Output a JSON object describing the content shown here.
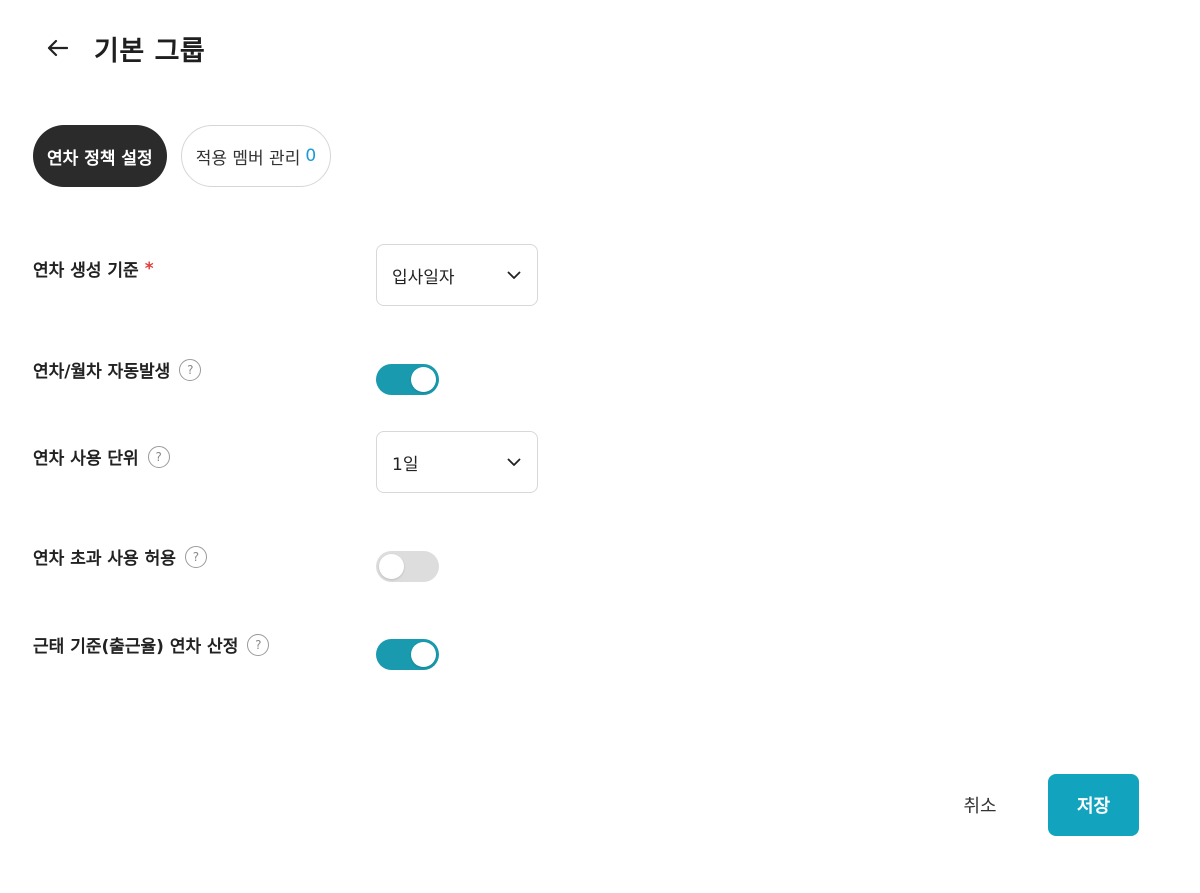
{
  "header": {
    "title": "기본 그룹",
    "back_icon": "arrow-left-icon"
  },
  "tabs": [
    {
      "label": "연차 정책 설정",
      "active": true
    },
    {
      "label": "적용 멤버 관리",
      "count": "0",
      "active": false
    }
  ],
  "settings": {
    "generation_basis": {
      "label": "연차 생성 기준",
      "required_mark": "*",
      "value": "입사일자"
    },
    "auto_generate": {
      "label": "연차/월차 자동발생",
      "help": "?",
      "enabled": true
    },
    "usage_unit": {
      "label": "연차 사용 단위",
      "help": "?",
      "value": "1일"
    },
    "allow_excess": {
      "label": "연차 초과 사용 허용",
      "help": "?",
      "enabled": false
    },
    "attendance_based": {
      "label": "근태 기준(출근율) 연차 산정",
      "help": "?",
      "enabled": true
    }
  },
  "footer": {
    "cancel_label": "취소",
    "save_label": "저장"
  },
  "colors": {
    "accent": "#12a4be",
    "toggle_on": "#1a9aae",
    "toggle_off": "#dddddd",
    "active_tab": "#2b2b2b",
    "count": "#1a9bd7",
    "required": "#e33a3a"
  }
}
